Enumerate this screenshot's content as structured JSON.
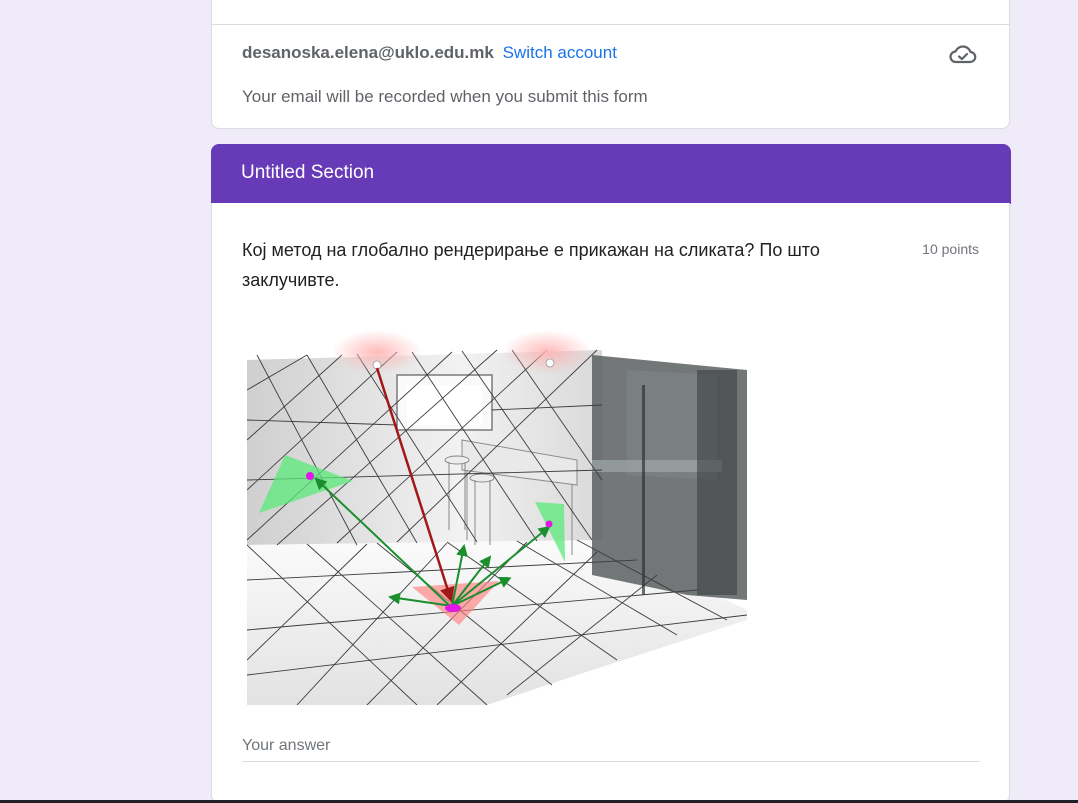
{
  "account": {
    "email": "desanoska.elena@uklo.edu.mk",
    "switch_label": "Switch account",
    "note": "Your email will be recorded when you submit this form",
    "status_icon": "cloud-saved-icon"
  },
  "section": {
    "title": "Untitled Section",
    "accent_color": "#673ab7"
  },
  "question": {
    "text": "Кој метод на глобално рендерирање е прикажан на сликата? По што заклучивте.",
    "points": "10 points",
    "answer_placeholder": "Your answer"
  }
}
